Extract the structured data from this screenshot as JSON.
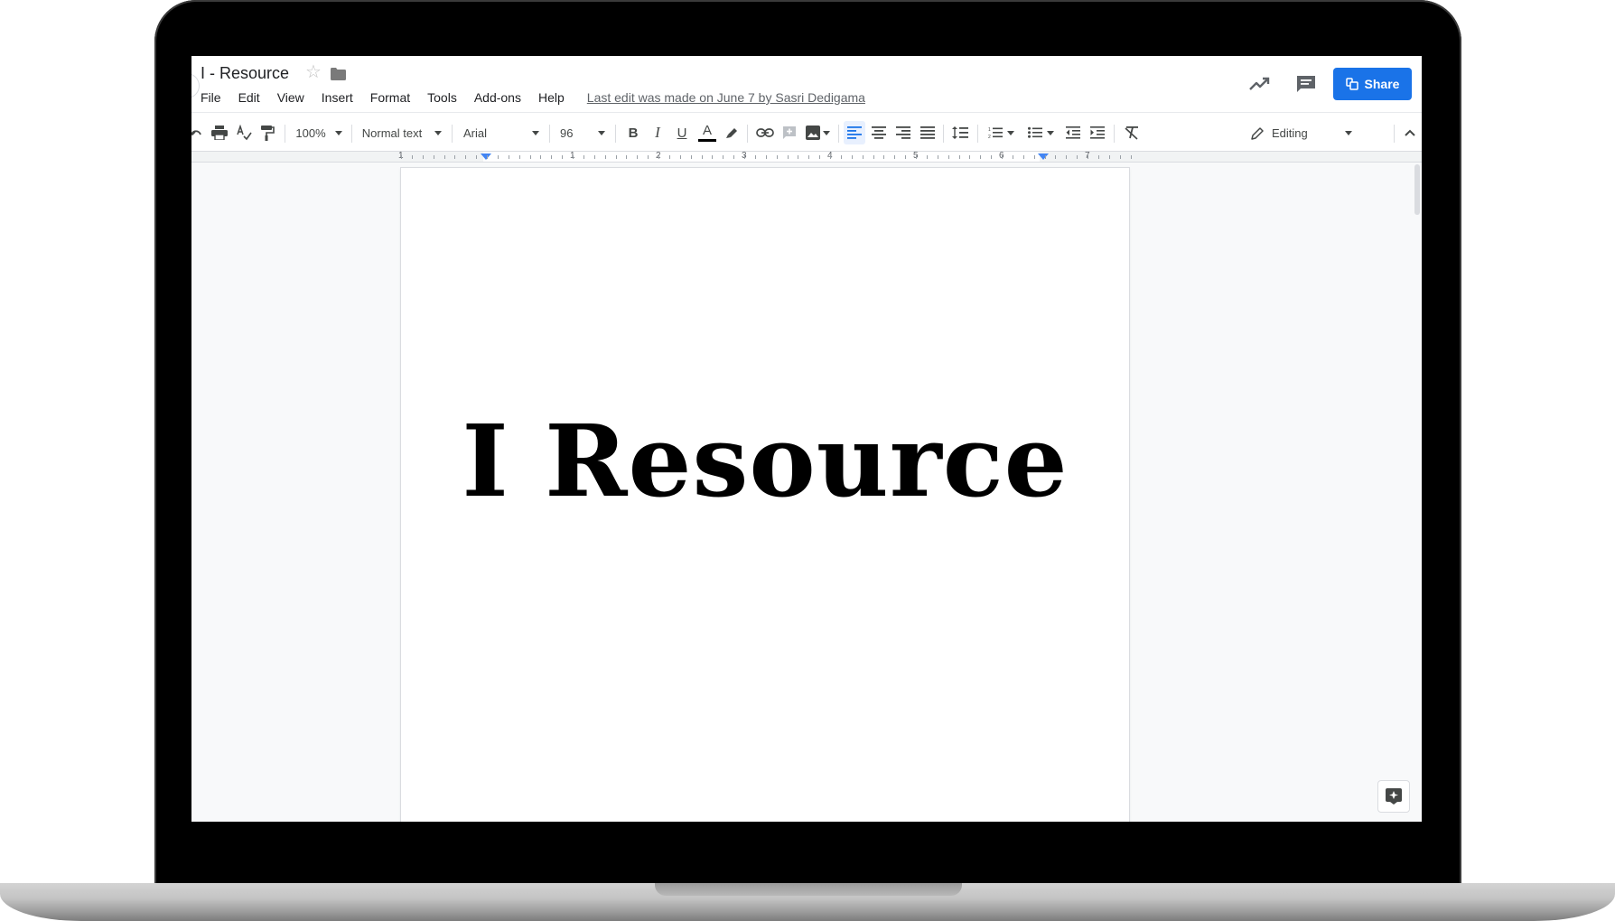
{
  "document": {
    "title": "I - Resource",
    "heading": "I Resource"
  },
  "menu": {
    "items": [
      "File",
      "Edit",
      "View",
      "Insert",
      "Format",
      "Tools",
      "Add-ons",
      "Help"
    ],
    "last_edit": "Last edit was made on June 7 by Sasri Dedigama"
  },
  "header": {
    "share_label": "Share"
  },
  "toolbar": {
    "zoom": "100%",
    "style": "Normal text",
    "font": "Arial",
    "font_size": "96",
    "mode": "Editing"
  },
  "ruler": {
    "numbers": [
      "1",
      "1",
      "2",
      "3",
      "4",
      "5",
      "6",
      "7"
    ]
  },
  "colors": {
    "accent": "#1a73e8",
    "text_color_bar": "#000000"
  },
  "icons": [
    "star-icon",
    "folder-icon",
    "activity-icon",
    "comment-icon",
    "undo-icon",
    "print-icon",
    "spellcheck-icon",
    "paint-format-icon",
    "bold-icon",
    "italic-icon",
    "underline-icon",
    "text-color-icon",
    "highlight-icon",
    "link-icon",
    "add-comment-icon",
    "image-icon",
    "align-left-icon",
    "align-center-icon",
    "align-right-icon",
    "justify-icon",
    "line-spacing-icon",
    "numbered-list-icon",
    "bulleted-list-icon",
    "decrease-indent-icon",
    "increase-indent-icon",
    "clear-formatting-icon",
    "pencil-icon",
    "collapse-icon",
    "explore-icon"
  ]
}
